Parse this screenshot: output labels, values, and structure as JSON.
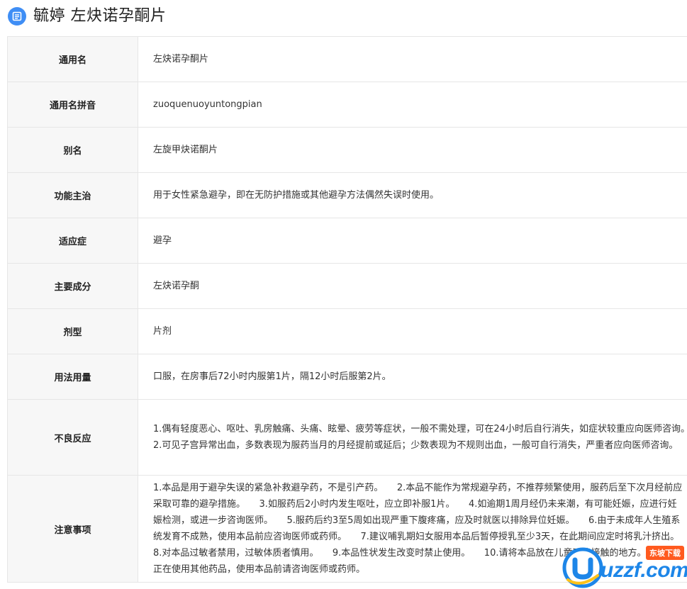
{
  "page": {
    "title": "毓婷 左炔诺孕酮片"
  },
  "rows": [
    {
      "label": "通用名",
      "value": "左炔诺孕酮片"
    },
    {
      "label": "通用名拼音",
      "value": "zuoquenuoyuntongpian"
    },
    {
      "label": "别名",
      "value": "左旋甲炔诺酮片"
    },
    {
      "label": "功能主治",
      "value": "用于女性紧急避孕，即在无防护措施或其他避孕方法偶然失误时使用。"
    },
    {
      "label": "适应症",
      "value": "避孕"
    },
    {
      "label": "主要成分",
      "value": "左炔诺孕酮"
    },
    {
      "label": "剂型",
      "value": "片剂"
    },
    {
      "label": "用法用量",
      "value": "口服，在房事后72小时内服第1片，隔12小时后服第2片。"
    },
    {
      "label": "不良反应",
      "value": "1.偶有轻度恶心、呕吐、乳房触痛、头痛、眩晕、疲劳等症状，一般不需处理，可在24小时后自行消失，如症状较重应向医师咨询。　　2.可见子宫异常出血，多数表现为服药当月的月经提前或延后；少数表现为不规则出血，一般可自行消失，严重者应向医师咨询。"
    },
    {
      "label": "注意事项",
      "value": "1.本品是用于避孕失误的紧急补救避孕药，不是引产药。　　2.本品不能作为常规避孕药，不推荐频繁使用，服药后至下次月经前应采取可靠的避孕措施。　　3.如服药后2小时内发生呕吐，应立即补服1片。　　4.如逾期1周月经仍未来潮，有可能妊娠，应进行妊娠检测，或进一步咨询医师。　　5.服药后约3至5周如出现严重下腹疼痛，应及时就医以排除异位妊娠。　　6.由于未成年人生殖系统发育不成熟，使用本品前应咨询医师或药师。　　7.建议哺乳期妇女服用本品后暂停授乳至少3天，在此期间应定时将乳汁挤出。　　8.对本品过敏者禁用，过敏体质者慎用。　　9.本品性状发生改变时禁止使用。　　10.请将本品放在儿童不能接触的地方。　　11.如正在使用其他药品，使用本品前请咨询医师或药师。"
    }
  ],
  "watermark": {
    "logo_text": "uzzf.com",
    "tag": "东坡下载"
  },
  "colors": {
    "accent": "#3f8ef5",
    "label_bg": "#f7f7f7",
    "border": "#e6e6e6",
    "watermark_blue": "#1d86e8",
    "watermark_tag": "#ff5a1f"
  },
  "icons": {
    "header": "document-list-icon"
  }
}
